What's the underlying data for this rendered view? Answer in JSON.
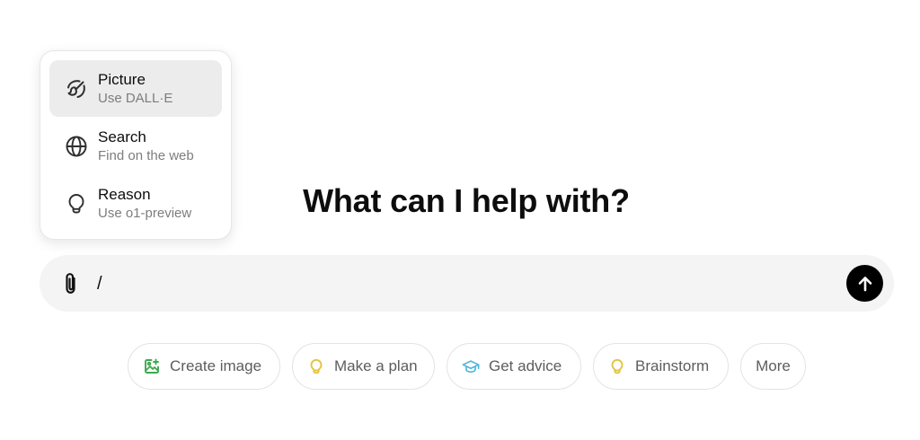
{
  "menu": {
    "items": [
      {
        "title": "Picture",
        "subtitle": "Use DALL·E",
        "icon": "paint-brush-icon",
        "active": true
      },
      {
        "title": "Search",
        "subtitle": "Find on the web",
        "icon": "globe-icon",
        "active": false
      },
      {
        "title": "Reason",
        "subtitle": "Use o1-preview",
        "icon": "lightbulb-icon",
        "active": false
      }
    ]
  },
  "main": {
    "heading": "What can I help with?"
  },
  "composer": {
    "value": "/",
    "attach_icon": "paperclip-icon",
    "send_icon": "arrow-up-icon"
  },
  "suggestions": [
    {
      "label": "Create image",
      "icon": "image-icon",
      "color": "#3fa94f"
    },
    {
      "label": "Make a plan",
      "icon": "lightbulb-icon",
      "color": "#e2c541"
    },
    {
      "label": "Get advice",
      "icon": "graduation-cap-icon",
      "color": "#4fb5d8"
    },
    {
      "label": "Brainstorm",
      "icon": "lightbulb-icon",
      "color": "#e2c541"
    },
    {
      "label": "More",
      "icon": "",
      "color": ""
    }
  ]
}
